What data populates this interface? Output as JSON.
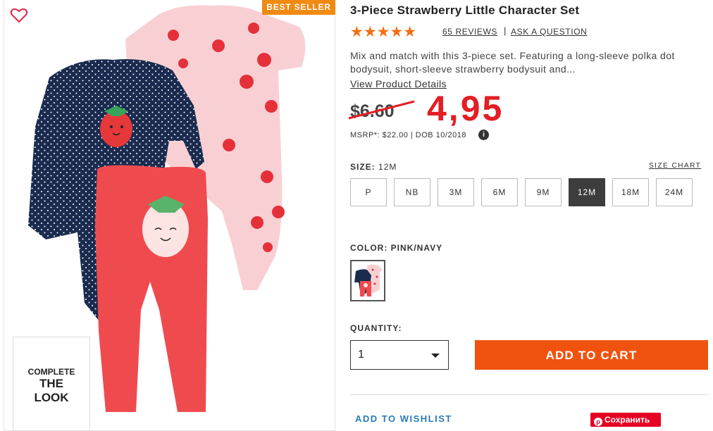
{
  "product": {
    "title": "3-Piece Strawberry Little Character Set",
    "badge": "BEST SELLER",
    "rating": 5,
    "stars": "★★★★★",
    "reviews_label": "65 REVIEWS",
    "separator": "|",
    "ask_label": "ASK A QUESTION",
    "description": "Mix and match with this 3-piece set. Featuring a long-sleeve polka dot bodysuit, short-sleeve strawberry bodysuit and...",
    "details_link": "View Product Details",
    "old_price": "$6.60",
    "new_price": "4,95",
    "msrp": "MSRP*: $22.00 | DOB 10/2018",
    "info_icon": "i"
  },
  "complete_look": {
    "line1": "COMPLETE",
    "line2": "THE",
    "line3": "LOOK"
  },
  "size": {
    "label": "SIZE:",
    "selected": "12M",
    "chart_link": "SIZE CHART",
    "options": [
      "P",
      "NB",
      "3M",
      "6M",
      "9M",
      "12M",
      "18M",
      "24M"
    ]
  },
  "color": {
    "label": "COLOR: PINK/NAVY"
  },
  "quantity": {
    "label": "QUANTITY:",
    "value": "1"
  },
  "actions": {
    "add_to_cart": "ADD TO CART",
    "wishlist": "ADD TO WISHLIST",
    "pin_label": "Сохранить",
    "pin_icon": "p"
  },
  "colors": {
    "accent_orange": "#f0530f",
    "badge_orange": "#f08a12",
    "star_orange": "#f36f13",
    "sale_red": "#e31e24",
    "link_blue": "#2a7ab8",
    "pinterest_red": "#e60023"
  }
}
